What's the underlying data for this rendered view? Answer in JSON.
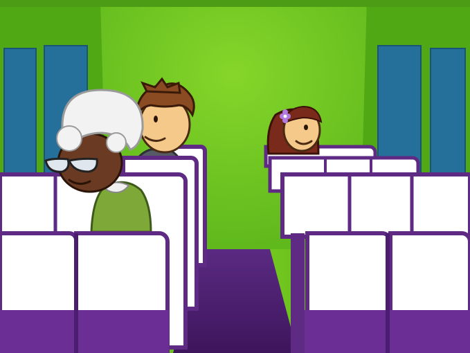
{
  "scene": {
    "palette": {
      "wall": "#58b418",
      "far_wall": "#72c61e",
      "window": "#24709a",
      "seat_back": "#ffffff",
      "seat_frame": "#5e2a84",
      "seat_shadow": "#8050a8",
      "aisle": "#4b1d6e"
    },
    "characters": [
      {
        "id": "elderly-woman",
        "icon": "elderly-woman-icon",
        "hair": "#f2f2f2",
        "skin": "#6b3a22",
        "outfit": "#7ea838",
        "glasses": true
      },
      {
        "id": "young-man",
        "icon": "young-man-icon",
        "hair": "#8a4a22",
        "skin": "#f4c98a",
        "outfit": "#555a66"
      },
      {
        "id": "girl-with-flower",
        "icon": "girl-with-flower-icon",
        "hair": "#7a2a1a",
        "skin": "#f4c98a",
        "accessory": "flower-hairclip-icon",
        "accessory_color": "#b07ae0"
      }
    ]
  }
}
